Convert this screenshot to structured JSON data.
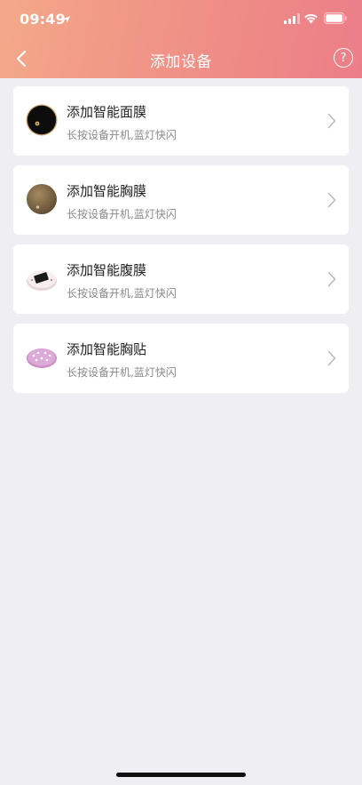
{
  "status_bar": {
    "time": "09:49",
    "location_icon": "location-arrow",
    "signal_icon": "signal-bars",
    "wifi_icon": "wifi",
    "battery_icon": "battery"
  },
  "nav": {
    "title": "添加设备",
    "back_icon": "chevron-left",
    "help_label": "?"
  },
  "devices": [
    {
      "title": "添加智能面膜",
      "subtitle": "长按设备开机,蓝灯快闪",
      "icon": "face-mask-device"
    },
    {
      "title": "添加智能胸膜",
      "subtitle": "长按设备开机,蓝灯快闪",
      "icon": "chest-mask-device"
    },
    {
      "title": "添加智能腹膜",
      "subtitle": "长按设备开机,蓝灯快闪",
      "icon": "abdomen-mask-device"
    },
    {
      "title": "添加智能胸贴",
      "subtitle": "长按设备开机,蓝灯快闪",
      "icon": "chest-patch-device"
    }
  ],
  "colors": {
    "header_start": "#f4a98a",
    "header_end": "#ec7e88",
    "background": "#efeef3",
    "card": "#ffffff"
  }
}
